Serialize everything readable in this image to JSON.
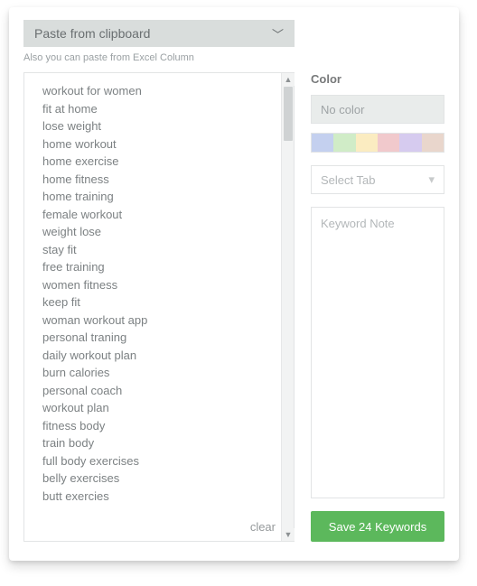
{
  "paste": {
    "label": "Paste from clipboard"
  },
  "hint": "Also you can paste from Excel Column",
  "keywords": [
    "workout for women",
    "fit at home",
    "lose weight",
    "home workout",
    "home exercise",
    "home fitness",
    "home training",
    "female workout",
    "weight lose",
    "stay fit",
    "free training",
    "women fitness",
    "keep fit",
    "woman workout app",
    "personal traning",
    "daily workout plan",
    "burn calories",
    "personal coach",
    "workout plan",
    "fitness body",
    "train body",
    "full body exercises",
    "belly exercises",
    "butt exercies"
  ],
  "clear_label": "clear",
  "color": {
    "section_label": "Color",
    "nocolor_label": "No color",
    "swatches": [
      "#c4d0ef",
      "#d0ecc7",
      "#fbecc1",
      "#f1c9cc",
      "#d6cbef",
      "#e9d6cc"
    ]
  },
  "tab_select": {
    "placeholder": "Select Tab"
  },
  "note": {
    "placeholder": "Keyword Note"
  },
  "save": {
    "label": "Save 24 Keywords"
  }
}
